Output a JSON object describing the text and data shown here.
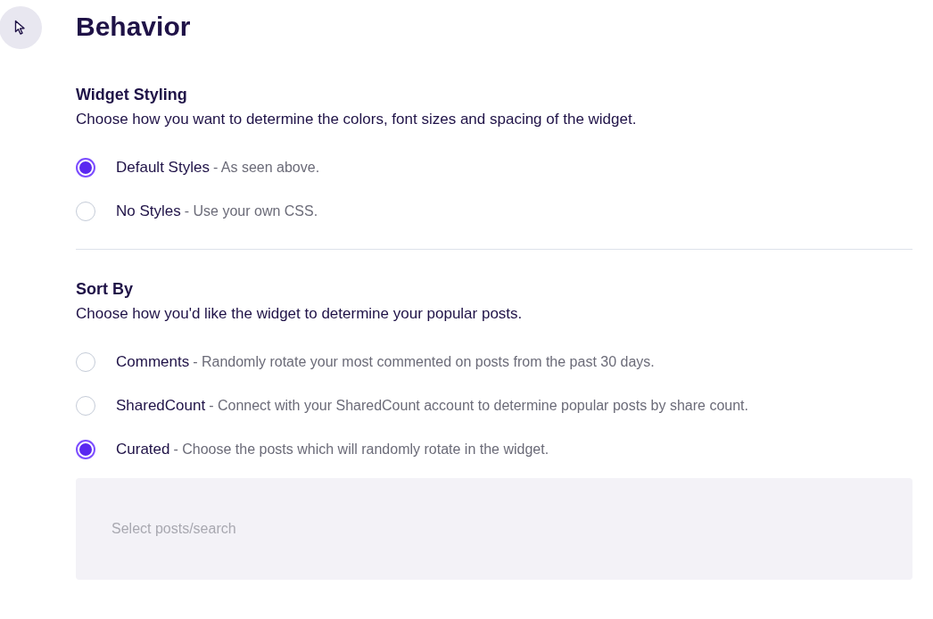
{
  "title": "Behavior",
  "sections": [
    {
      "heading": "Widget Styling",
      "description": "Choose how you want to determine the colors, font sizes and spacing of the widget.",
      "options": [
        {
          "label": "Default Styles",
          "description": "- As seen above.",
          "selected": true
        },
        {
          "label": "No Styles",
          "description": "- Use your own CSS.",
          "selected": false
        }
      ]
    },
    {
      "heading": "Sort By",
      "description": "Choose how you'd like the widget to determine your popular posts.",
      "options": [
        {
          "label": "Comments",
          "description": "- Randomly rotate your most commented on posts from the past 30 days.",
          "selected": false
        },
        {
          "label": "SharedCount",
          "description": "- Connect with your SharedCount account to determine popular posts by share count.",
          "selected": false
        },
        {
          "label": "Curated",
          "description": "- Choose the posts which will randomly rotate in the widget.",
          "selected": true
        }
      ],
      "search": {
        "placeholder": "Select posts/search"
      }
    }
  ]
}
